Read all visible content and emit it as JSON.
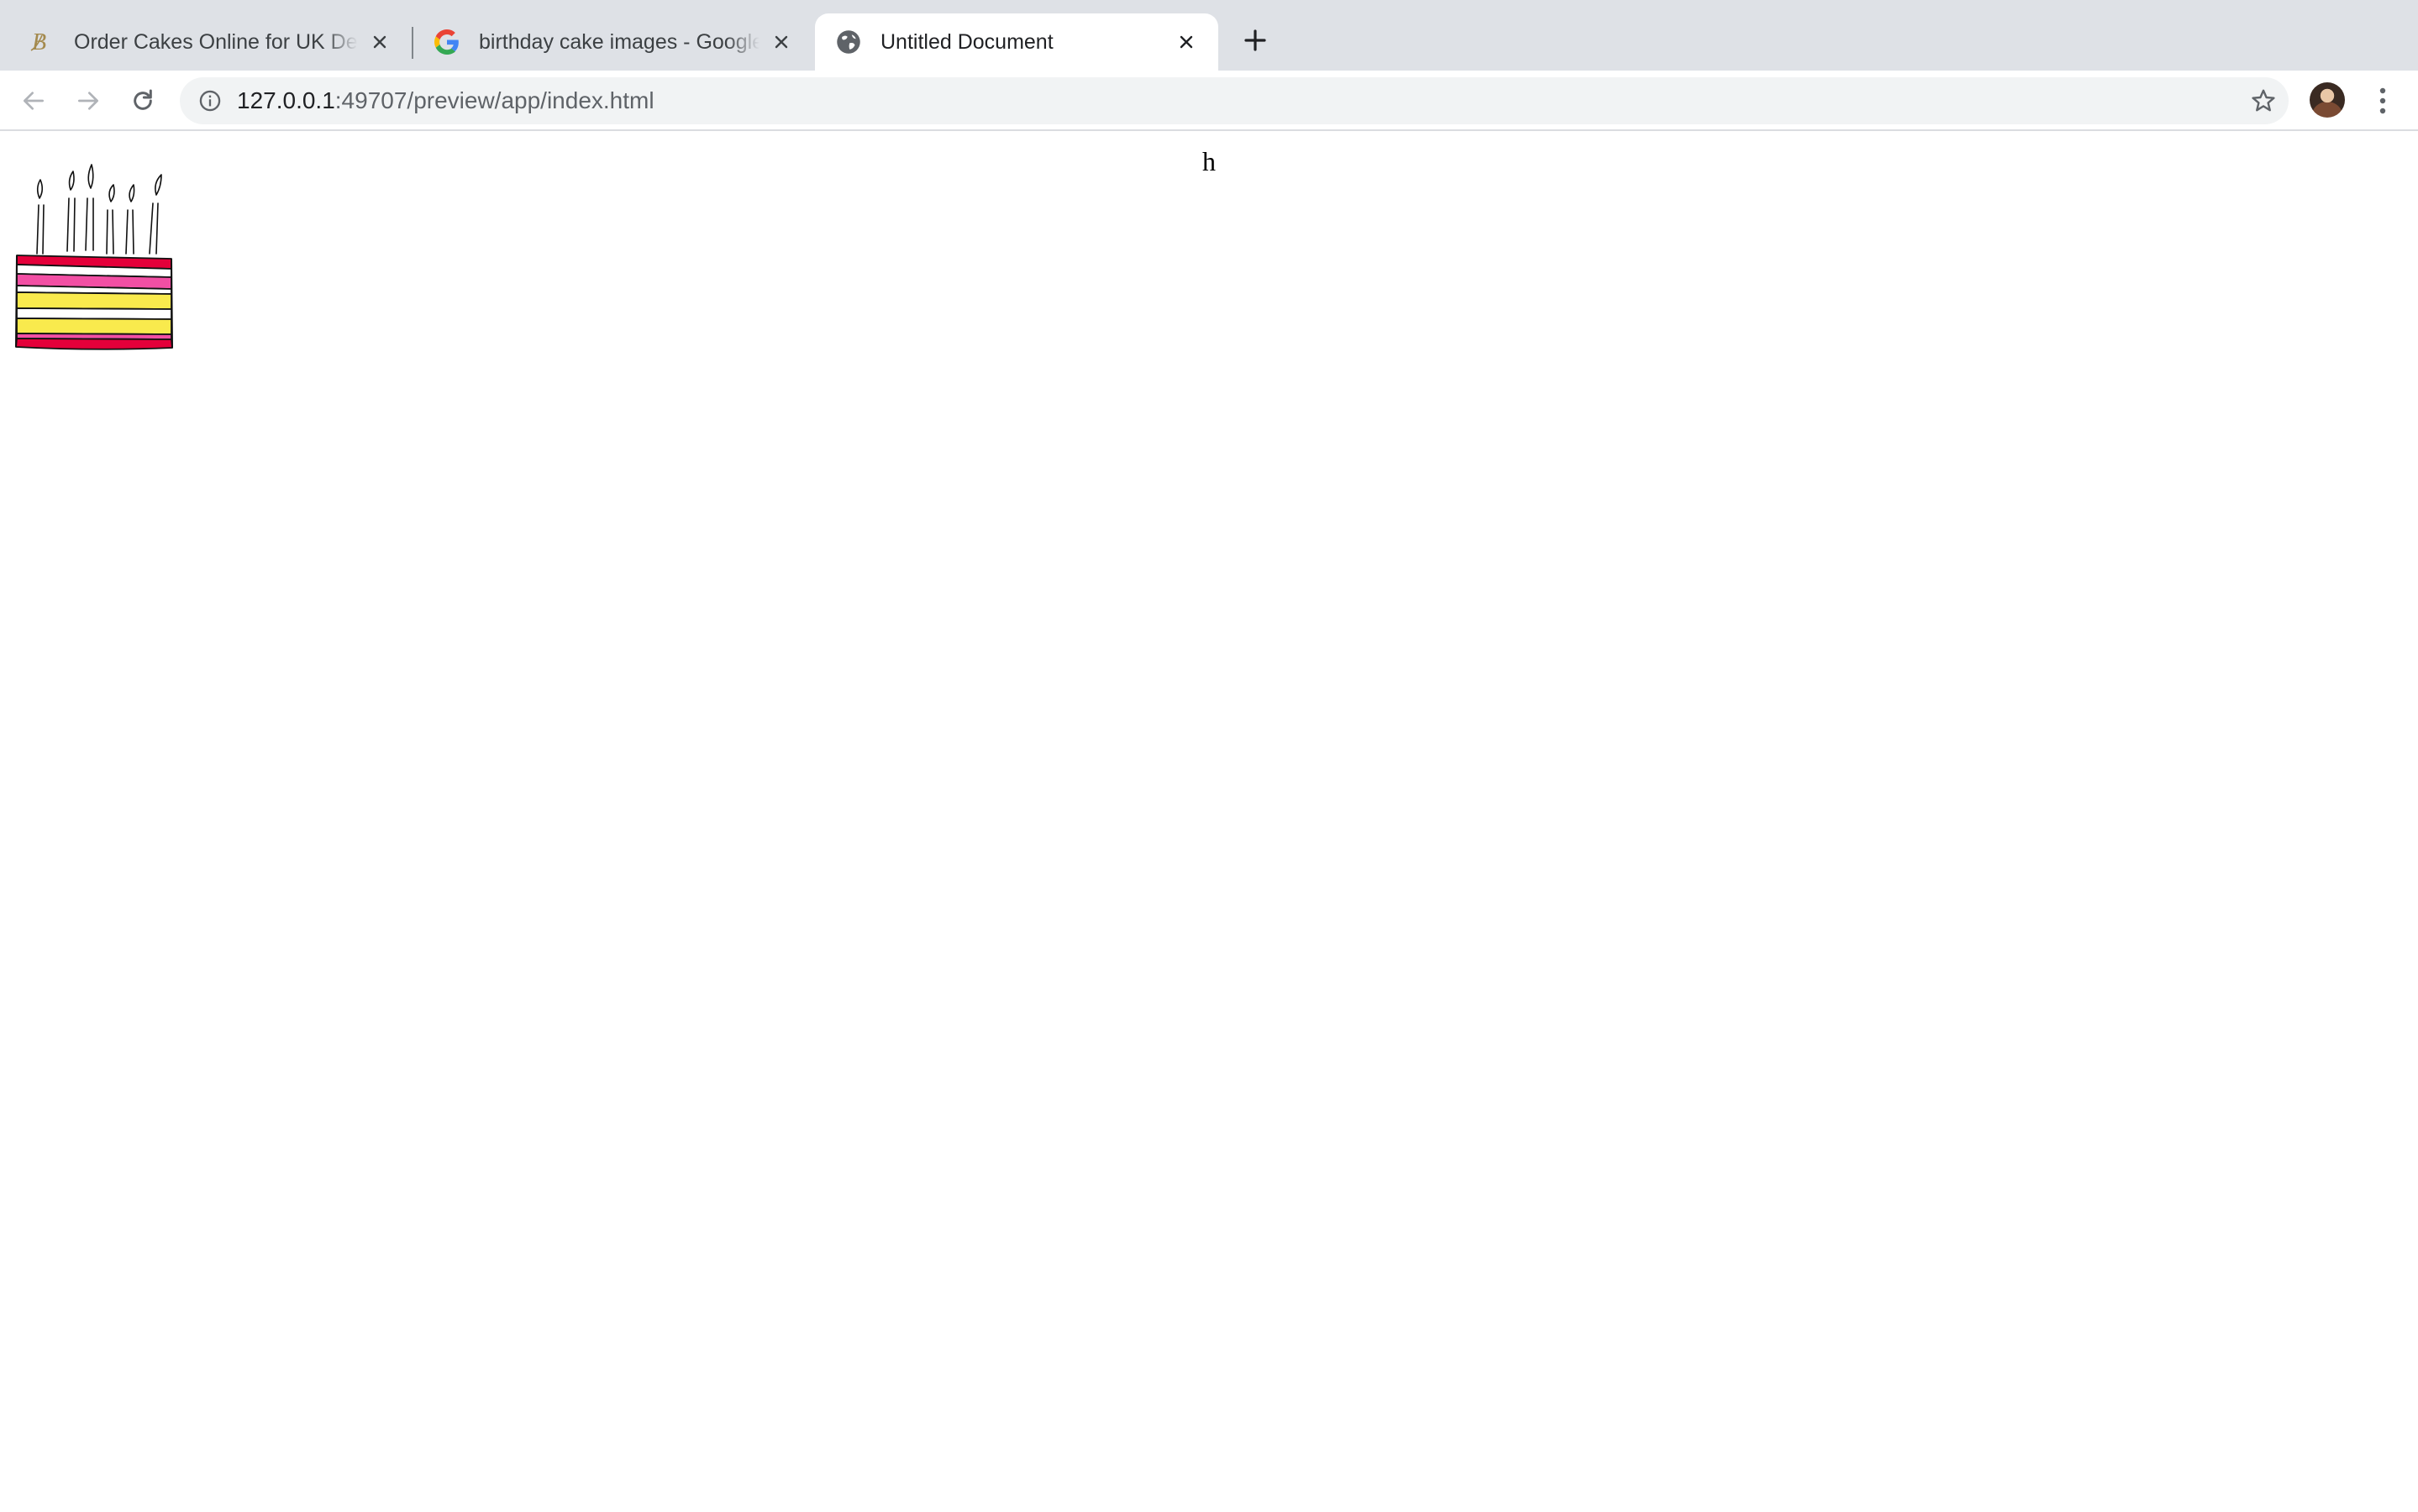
{
  "browser": {
    "tabs": [
      {
        "title": "Order Cakes Online for UK Deli",
        "favicon": "script-b-icon",
        "active": false
      },
      {
        "title": "birthday cake images - Google",
        "favicon": "google-g-icon",
        "active": false
      },
      {
        "title": "Untitled Document",
        "favicon": "globe-icon",
        "active": true
      }
    ],
    "new_tab_icon": "plus-icon",
    "address": {
      "host": "127.0.0.1",
      "rest": ":49707/preview/app/index.html"
    },
    "icons": {
      "back": "arrow-left-icon",
      "forward": "arrow-right-icon",
      "reload": "reload-icon",
      "site_info": "info-icon",
      "bookmark": "star-icon",
      "profile": "avatar",
      "menu": "kebab-menu-icon"
    }
  },
  "page": {
    "text": "h",
    "image": "birthday-cake-with-candles",
    "colors": {
      "red": "#e4003a",
      "pink": "#f24fa4",
      "yellow": "#f9ea4d",
      "white": "#ffffff"
    }
  }
}
